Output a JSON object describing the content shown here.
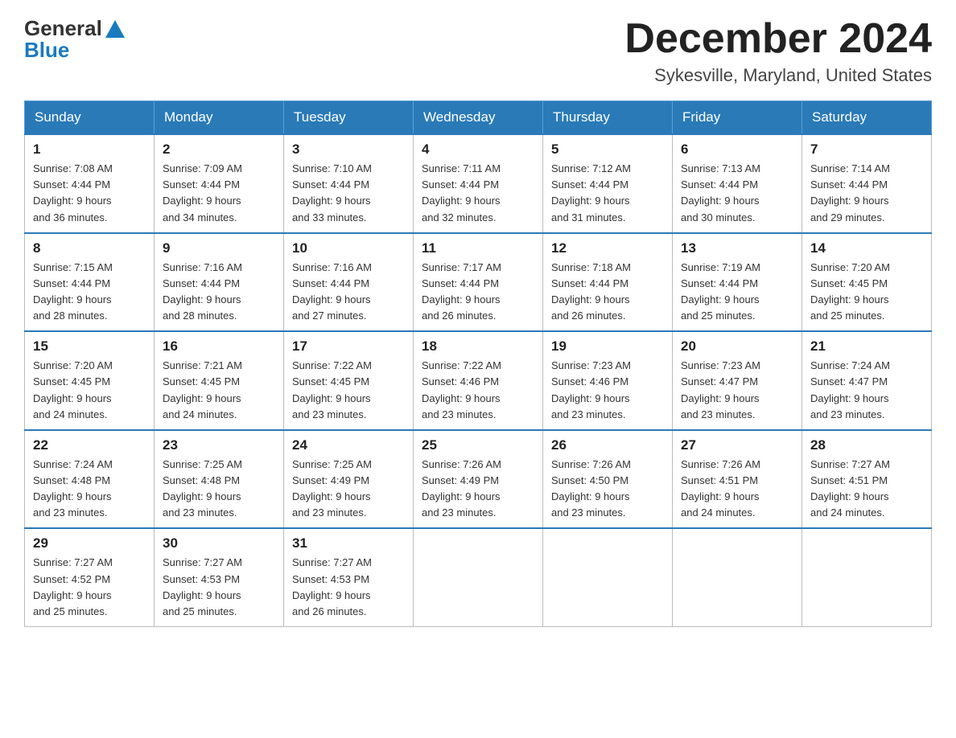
{
  "header": {
    "logo_text_general": "General",
    "logo_text_blue": "Blue",
    "month_title": "December 2024",
    "location": "Sykesville, Maryland, United States"
  },
  "weekdays": [
    "Sunday",
    "Monday",
    "Tuesday",
    "Wednesday",
    "Thursday",
    "Friday",
    "Saturday"
  ],
  "weeks": [
    [
      {
        "day": "1",
        "sunrise": "7:08 AM",
        "sunset": "4:44 PM",
        "daylight": "9 hours and 36 minutes."
      },
      {
        "day": "2",
        "sunrise": "7:09 AM",
        "sunset": "4:44 PM",
        "daylight": "9 hours and 34 minutes."
      },
      {
        "day": "3",
        "sunrise": "7:10 AM",
        "sunset": "4:44 PM",
        "daylight": "9 hours and 33 minutes."
      },
      {
        "day": "4",
        "sunrise": "7:11 AM",
        "sunset": "4:44 PM",
        "daylight": "9 hours and 32 minutes."
      },
      {
        "day": "5",
        "sunrise": "7:12 AM",
        "sunset": "4:44 PM",
        "daylight": "9 hours and 31 minutes."
      },
      {
        "day": "6",
        "sunrise": "7:13 AM",
        "sunset": "4:44 PM",
        "daylight": "9 hours and 30 minutes."
      },
      {
        "day": "7",
        "sunrise": "7:14 AM",
        "sunset": "4:44 PM",
        "daylight": "9 hours and 29 minutes."
      }
    ],
    [
      {
        "day": "8",
        "sunrise": "7:15 AM",
        "sunset": "4:44 PM",
        "daylight": "9 hours and 28 minutes."
      },
      {
        "day": "9",
        "sunrise": "7:16 AM",
        "sunset": "4:44 PM",
        "daylight": "9 hours and 28 minutes."
      },
      {
        "day": "10",
        "sunrise": "7:16 AM",
        "sunset": "4:44 PM",
        "daylight": "9 hours and 27 minutes."
      },
      {
        "day": "11",
        "sunrise": "7:17 AM",
        "sunset": "4:44 PM",
        "daylight": "9 hours and 26 minutes."
      },
      {
        "day": "12",
        "sunrise": "7:18 AM",
        "sunset": "4:44 PM",
        "daylight": "9 hours and 26 minutes."
      },
      {
        "day": "13",
        "sunrise": "7:19 AM",
        "sunset": "4:44 PM",
        "daylight": "9 hours and 25 minutes."
      },
      {
        "day": "14",
        "sunrise": "7:20 AM",
        "sunset": "4:45 PM",
        "daylight": "9 hours and 25 minutes."
      }
    ],
    [
      {
        "day": "15",
        "sunrise": "7:20 AM",
        "sunset": "4:45 PM",
        "daylight": "9 hours and 24 minutes."
      },
      {
        "day": "16",
        "sunrise": "7:21 AM",
        "sunset": "4:45 PM",
        "daylight": "9 hours and 24 minutes."
      },
      {
        "day": "17",
        "sunrise": "7:22 AM",
        "sunset": "4:45 PM",
        "daylight": "9 hours and 23 minutes."
      },
      {
        "day": "18",
        "sunrise": "7:22 AM",
        "sunset": "4:46 PM",
        "daylight": "9 hours and 23 minutes."
      },
      {
        "day": "19",
        "sunrise": "7:23 AM",
        "sunset": "4:46 PM",
        "daylight": "9 hours and 23 minutes."
      },
      {
        "day": "20",
        "sunrise": "7:23 AM",
        "sunset": "4:47 PM",
        "daylight": "9 hours and 23 minutes."
      },
      {
        "day": "21",
        "sunrise": "7:24 AM",
        "sunset": "4:47 PM",
        "daylight": "9 hours and 23 minutes."
      }
    ],
    [
      {
        "day": "22",
        "sunrise": "7:24 AM",
        "sunset": "4:48 PM",
        "daylight": "9 hours and 23 minutes."
      },
      {
        "day": "23",
        "sunrise": "7:25 AM",
        "sunset": "4:48 PM",
        "daylight": "9 hours and 23 minutes."
      },
      {
        "day": "24",
        "sunrise": "7:25 AM",
        "sunset": "4:49 PM",
        "daylight": "9 hours and 23 minutes."
      },
      {
        "day": "25",
        "sunrise": "7:26 AM",
        "sunset": "4:49 PM",
        "daylight": "9 hours and 23 minutes."
      },
      {
        "day": "26",
        "sunrise": "7:26 AM",
        "sunset": "4:50 PM",
        "daylight": "9 hours and 23 minutes."
      },
      {
        "day": "27",
        "sunrise": "7:26 AM",
        "sunset": "4:51 PM",
        "daylight": "9 hours and 24 minutes."
      },
      {
        "day": "28",
        "sunrise": "7:27 AM",
        "sunset": "4:51 PM",
        "daylight": "9 hours and 24 minutes."
      }
    ],
    [
      {
        "day": "29",
        "sunrise": "7:27 AM",
        "sunset": "4:52 PM",
        "daylight": "9 hours and 25 minutes."
      },
      {
        "day": "30",
        "sunrise": "7:27 AM",
        "sunset": "4:53 PM",
        "daylight": "9 hours and 25 minutes."
      },
      {
        "day": "31",
        "sunrise": "7:27 AM",
        "sunset": "4:53 PM",
        "daylight": "9 hours and 26 minutes."
      },
      null,
      null,
      null,
      null
    ]
  ],
  "labels": {
    "sunrise": "Sunrise:",
    "sunset": "Sunset:",
    "daylight": "Daylight:"
  }
}
